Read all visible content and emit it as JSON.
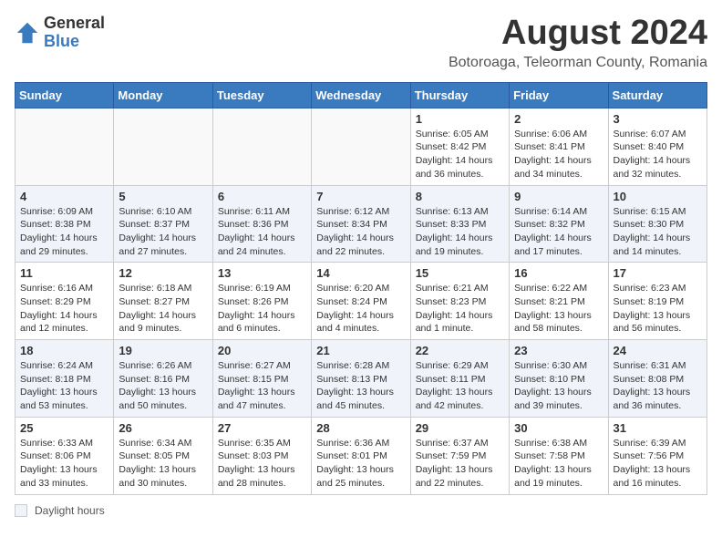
{
  "header": {
    "logo_general": "General",
    "logo_blue": "Blue",
    "month_year": "August 2024",
    "location": "Botoroaga, Teleorman County, Romania"
  },
  "calendar": {
    "weekdays": [
      "Sunday",
      "Monday",
      "Tuesday",
      "Wednesday",
      "Thursday",
      "Friday",
      "Saturday"
    ],
    "weeks": [
      [
        {
          "day": "",
          "info": ""
        },
        {
          "day": "",
          "info": ""
        },
        {
          "day": "",
          "info": ""
        },
        {
          "day": "",
          "info": ""
        },
        {
          "day": "1",
          "info": "Sunrise: 6:05 AM\nSunset: 8:42 PM\nDaylight: 14 hours and 36 minutes."
        },
        {
          "day": "2",
          "info": "Sunrise: 6:06 AM\nSunset: 8:41 PM\nDaylight: 14 hours and 34 minutes."
        },
        {
          "day": "3",
          "info": "Sunrise: 6:07 AM\nSunset: 8:40 PM\nDaylight: 14 hours and 32 minutes."
        }
      ],
      [
        {
          "day": "4",
          "info": "Sunrise: 6:09 AM\nSunset: 8:38 PM\nDaylight: 14 hours and 29 minutes."
        },
        {
          "day": "5",
          "info": "Sunrise: 6:10 AM\nSunset: 8:37 PM\nDaylight: 14 hours and 27 minutes."
        },
        {
          "day": "6",
          "info": "Sunrise: 6:11 AM\nSunset: 8:36 PM\nDaylight: 14 hours and 24 minutes."
        },
        {
          "day": "7",
          "info": "Sunrise: 6:12 AM\nSunset: 8:34 PM\nDaylight: 14 hours and 22 minutes."
        },
        {
          "day": "8",
          "info": "Sunrise: 6:13 AM\nSunset: 8:33 PM\nDaylight: 14 hours and 19 minutes."
        },
        {
          "day": "9",
          "info": "Sunrise: 6:14 AM\nSunset: 8:32 PM\nDaylight: 14 hours and 17 minutes."
        },
        {
          "day": "10",
          "info": "Sunrise: 6:15 AM\nSunset: 8:30 PM\nDaylight: 14 hours and 14 minutes."
        }
      ],
      [
        {
          "day": "11",
          "info": "Sunrise: 6:16 AM\nSunset: 8:29 PM\nDaylight: 14 hours and 12 minutes."
        },
        {
          "day": "12",
          "info": "Sunrise: 6:18 AM\nSunset: 8:27 PM\nDaylight: 14 hours and 9 minutes."
        },
        {
          "day": "13",
          "info": "Sunrise: 6:19 AM\nSunset: 8:26 PM\nDaylight: 14 hours and 6 minutes."
        },
        {
          "day": "14",
          "info": "Sunrise: 6:20 AM\nSunset: 8:24 PM\nDaylight: 14 hours and 4 minutes."
        },
        {
          "day": "15",
          "info": "Sunrise: 6:21 AM\nSunset: 8:23 PM\nDaylight: 14 hours and 1 minute."
        },
        {
          "day": "16",
          "info": "Sunrise: 6:22 AM\nSunset: 8:21 PM\nDaylight: 13 hours and 58 minutes."
        },
        {
          "day": "17",
          "info": "Sunrise: 6:23 AM\nSunset: 8:19 PM\nDaylight: 13 hours and 56 minutes."
        }
      ],
      [
        {
          "day": "18",
          "info": "Sunrise: 6:24 AM\nSunset: 8:18 PM\nDaylight: 13 hours and 53 minutes."
        },
        {
          "day": "19",
          "info": "Sunrise: 6:26 AM\nSunset: 8:16 PM\nDaylight: 13 hours and 50 minutes."
        },
        {
          "day": "20",
          "info": "Sunrise: 6:27 AM\nSunset: 8:15 PM\nDaylight: 13 hours and 47 minutes."
        },
        {
          "day": "21",
          "info": "Sunrise: 6:28 AM\nSunset: 8:13 PM\nDaylight: 13 hours and 45 minutes."
        },
        {
          "day": "22",
          "info": "Sunrise: 6:29 AM\nSunset: 8:11 PM\nDaylight: 13 hours and 42 minutes."
        },
        {
          "day": "23",
          "info": "Sunrise: 6:30 AM\nSunset: 8:10 PM\nDaylight: 13 hours and 39 minutes."
        },
        {
          "day": "24",
          "info": "Sunrise: 6:31 AM\nSunset: 8:08 PM\nDaylight: 13 hours and 36 minutes."
        }
      ],
      [
        {
          "day": "25",
          "info": "Sunrise: 6:33 AM\nSunset: 8:06 PM\nDaylight: 13 hours and 33 minutes."
        },
        {
          "day": "26",
          "info": "Sunrise: 6:34 AM\nSunset: 8:05 PM\nDaylight: 13 hours and 30 minutes."
        },
        {
          "day": "27",
          "info": "Sunrise: 6:35 AM\nSunset: 8:03 PM\nDaylight: 13 hours and 28 minutes."
        },
        {
          "day": "28",
          "info": "Sunrise: 6:36 AM\nSunset: 8:01 PM\nDaylight: 13 hours and 25 minutes."
        },
        {
          "day": "29",
          "info": "Sunrise: 6:37 AM\nSunset: 7:59 PM\nDaylight: 13 hours and 22 minutes."
        },
        {
          "day": "30",
          "info": "Sunrise: 6:38 AM\nSunset: 7:58 PM\nDaylight: 13 hours and 19 minutes."
        },
        {
          "day": "31",
          "info": "Sunrise: 6:39 AM\nSunset: 7:56 PM\nDaylight: 13 hours and 16 minutes."
        }
      ]
    ]
  },
  "footer": {
    "daylight_label": "Daylight hours"
  }
}
